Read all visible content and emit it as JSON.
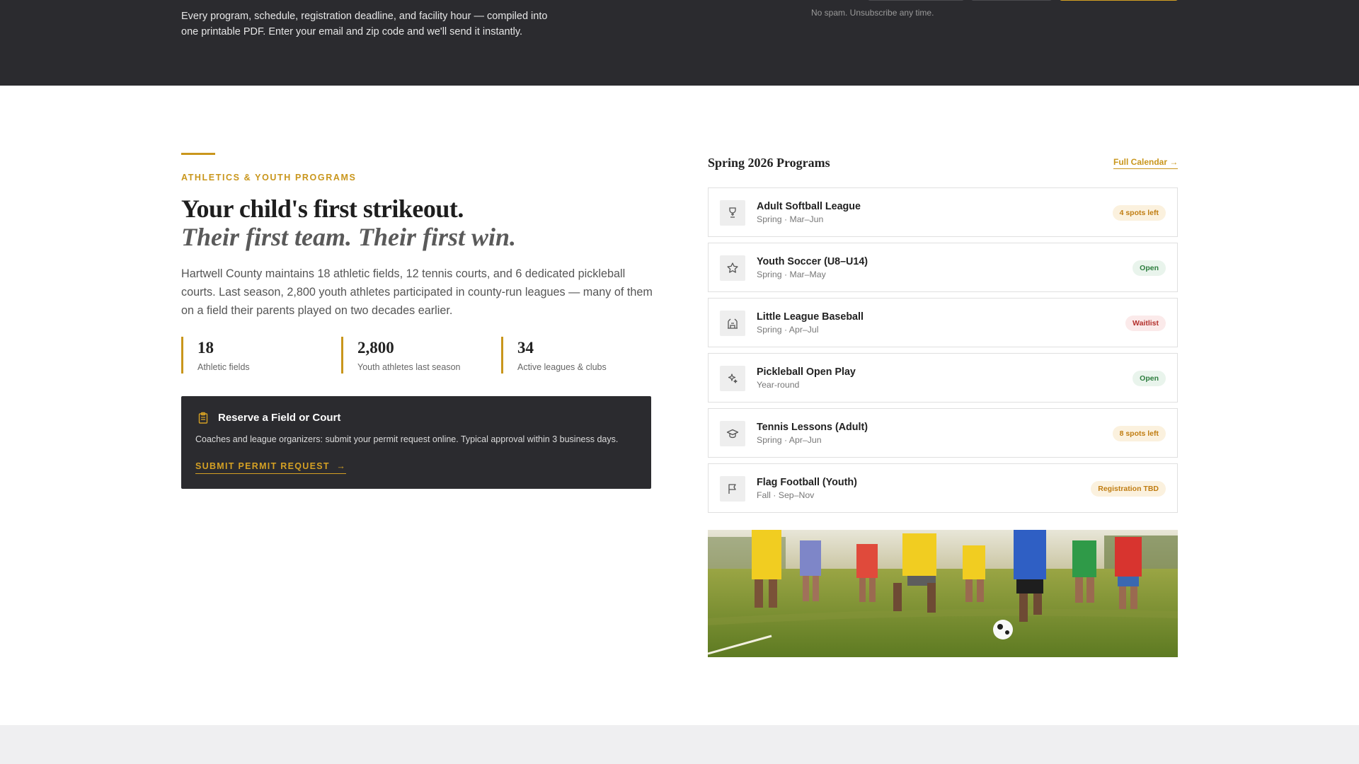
{
  "top_banner": {
    "description": "Every program, schedule, registration deadline, and facility hour — compiled into one printable PDF. Enter your email and zip code and we'll send it instantly.",
    "no_spam_note": "No spam. Unsubscribe any time."
  },
  "hero": {
    "eyebrow": "ATHLETICS & YOUTH PROGRAMS",
    "headline": "Your child's first strikeout.",
    "subheadline": "Their first team. Their first win.",
    "intro": "Hartwell County maintains 18 athletic fields, 12 tennis courts, and 6 dedicated pickleball courts. Last season, 2,800 youth athletes participated in county-run leagues — many of them on a field their parents played on two decades earlier."
  },
  "stats": [
    {
      "value": "18",
      "label": "Athletic fields"
    },
    {
      "value": "2,800",
      "label": "Youth athletes last season"
    },
    {
      "value": "34",
      "label": "Active leagues & clubs"
    }
  ],
  "permit_card": {
    "icon": "clipboard-icon",
    "title": "Reserve a Field or Court",
    "description": "Coaches and league organizers: submit your permit request online. Typical approval within 3 business days.",
    "link_label": "SUBMIT PERMIT REQUEST",
    "link_arrow": "→"
  },
  "programs": {
    "title": "Spring 2026 Programs",
    "calendar_link": "Full Calendar →",
    "items": [
      {
        "icon": "trophy-icon",
        "name": "Adult Softball League",
        "meta": "Spring · Mar–Jun",
        "status": "4 spots left",
        "status_type": "warn"
      },
      {
        "icon": "star-icon",
        "name": "Youth Soccer (U8–U14)",
        "meta": "Spring · Mar–May",
        "status": "Open",
        "status_type": "open"
      },
      {
        "icon": "stadium-icon",
        "name": "Little League Baseball",
        "meta": "Spring · Apr–Jul",
        "status": "Waitlist",
        "status_type": "wait"
      },
      {
        "icon": "sparkle-icon",
        "name": "Pickleball Open Play",
        "meta": "Year-round",
        "status": "Open",
        "status_type": "open"
      },
      {
        "icon": "graduation-cap-icon",
        "name": "Tennis Lessons (Adult)",
        "meta": "Spring · Apr–Jun",
        "status": "8 spots left",
        "status_type": "warn"
      },
      {
        "icon": "flag-icon",
        "name": "Flag Football (Youth)",
        "meta": "Fall · Sep–Nov",
        "status": "Registration TBD",
        "status_type": "warn"
      }
    ]
  },
  "colors": {
    "accent": "#c9961c",
    "dark_band": "#2b2b2f",
    "open_green": "#2d7d3e",
    "waitlist_red": "#b3302c"
  }
}
